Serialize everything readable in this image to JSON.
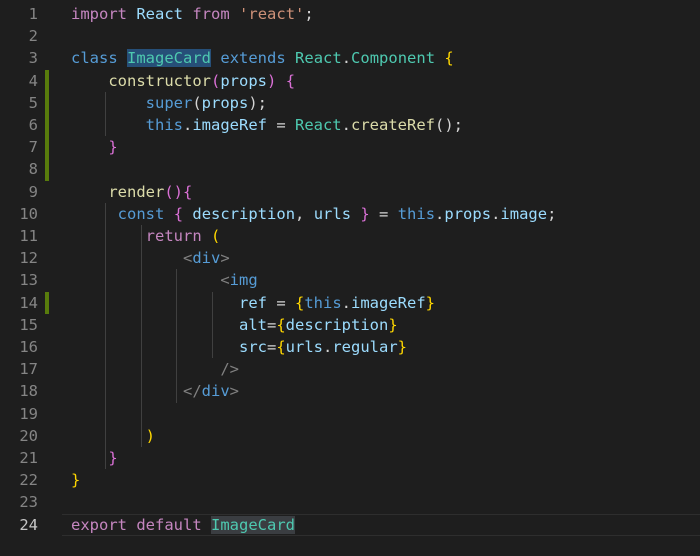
{
  "editor": {
    "active_line": "24",
    "lines": [
      {
        "n": "1",
        "tokens": [
          [
            "kw2",
            "import"
          ],
          [
            "plain",
            " "
          ],
          [
            "var",
            "React"
          ],
          [
            "plain",
            " "
          ],
          [
            "kw2",
            "from"
          ],
          [
            "plain",
            " "
          ],
          [
            "str",
            "'react'"
          ],
          [
            "plain",
            ";"
          ]
        ]
      },
      {
        "n": "2",
        "tokens": []
      },
      {
        "n": "3",
        "tokens": [
          [
            "kw",
            "class"
          ],
          [
            "plain",
            " "
          ],
          [
            "cls hl1",
            "ImageCard"
          ],
          [
            "plain",
            " "
          ],
          [
            "kw",
            "extends"
          ],
          [
            "plain",
            " "
          ],
          [
            "cls",
            "React"
          ],
          [
            "plain",
            "."
          ],
          [
            "cls",
            "Component"
          ],
          [
            "plain",
            " "
          ],
          [
            "brace",
            "{"
          ]
        ]
      },
      {
        "n": "4",
        "tokens": [
          [
            "plain",
            "    "
          ],
          [
            "fn",
            "constructor"
          ],
          [
            "paren",
            "("
          ],
          [
            "var",
            "props"
          ],
          [
            "paren",
            ")"
          ],
          [
            "plain",
            " "
          ],
          [
            "paren",
            "{"
          ]
        ]
      },
      {
        "n": "5",
        "tokens": [
          [
            "plain",
            "        "
          ],
          [
            "kw",
            "super"
          ],
          [
            "plain",
            "("
          ],
          [
            "var",
            "props"
          ],
          [
            "plain",
            ");"
          ]
        ]
      },
      {
        "n": "6",
        "tokens": [
          [
            "plain",
            "        "
          ],
          [
            "kw",
            "this"
          ],
          [
            "plain",
            "."
          ],
          [
            "var",
            "imageRef"
          ],
          [
            "plain",
            " = "
          ],
          [
            "cls",
            "React"
          ],
          [
            "plain",
            "."
          ],
          [
            "fn",
            "createRef"
          ],
          [
            "plain",
            "();"
          ]
        ]
      },
      {
        "n": "7",
        "tokens": [
          [
            "plain",
            "    "
          ],
          [
            "paren",
            "}"
          ]
        ]
      },
      {
        "n": "8",
        "tokens": []
      },
      {
        "n": "9",
        "tokens": [
          [
            "plain",
            "    "
          ],
          [
            "fn",
            "render"
          ],
          [
            "paren",
            "()"
          ],
          [
            "paren",
            "{"
          ]
        ]
      },
      {
        "n": "10",
        "tokens": [
          [
            "plain",
            "     "
          ],
          [
            "kw",
            "const"
          ],
          [
            "plain",
            " "
          ],
          [
            "paren",
            "{"
          ],
          [
            "plain",
            " "
          ],
          [
            "var",
            "description"
          ],
          [
            "plain",
            ", "
          ],
          [
            "var",
            "urls"
          ],
          [
            "plain",
            " "
          ],
          [
            "paren",
            "}"
          ],
          [
            "plain",
            " = "
          ],
          [
            "kw",
            "this"
          ],
          [
            "plain",
            "."
          ],
          [
            "var",
            "props"
          ],
          [
            "plain",
            "."
          ],
          [
            "var",
            "image"
          ],
          [
            "plain",
            ";"
          ]
        ]
      },
      {
        "n": "11",
        "tokens": [
          [
            "plain",
            "        "
          ],
          [
            "kw2",
            "return"
          ],
          [
            "plain",
            " "
          ],
          [
            "brace",
            "("
          ]
        ]
      },
      {
        "n": "12",
        "tokens": [
          [
            "plain",
            "            "
          ],
          [
            "tagbr",
            "<"
          ],
          [
            "tag",
            "div"
          ],
          [
            "tagbr",
            ">"
          ]
        ]
      },
      {
        "n": "13",
        "tokens": [
          [
            "plain",
            "                "
          ],
          [
            "tagbr",
            "<"
          ],
          [
            "tag",
            "img"
          ]
        ]
      },
      {
        "n": "14",
        "tokens": [
          [
            "plain",
            "                  "
          ],
          [
            "attr",
            "ref"
          ],
          [
            "plain",
            " = "
          ],
          [
            "brace",
            "{"
          ],
          [
            "kw",
            "this"
          ],
          [
            "plain",
            "."
          ],
          [
            "var",
            "imageRef"
          ],
          [
            "brace",
            "}"
          ]
        ]
      },
      {
        "n": "15",
        "tokens": [
          [
            "plain",
            "                  "
          ],
          [
            "attr",
            "alt"
          ],
          [
            "plain",
            "="
          ],
          [
            "brace",
            "{"
          ],
          [
            "var",
            "description"
          ],
          [
            "brace",
            "}"
          ]
        ]
      },
      {
        "n": "16",
        "tokens": [
          [
            "plain",
            "                  "
          ],
          [
            "attr",
            "src"
          ],
          [
            "plain",
            "="
          ],
          [
            "brace",
            "{"
          ],
          [
            "var",
            "urls"
          ],
          [
            "plain",
            "."
          ],
          [
            "var",
            "regular"
          ],
          [
            "brace",
            "}"
          ]
        ]
      },
      {
        "n": "17",
        "tokens": [
          [
            "plain",
            "                "
          ],
          [
            "tagbr",
            "/>"
          ]
        ]
      },
      {
        "n": "18",
        "tokens": [
          [
            "plain",
            "            "
          ],
          [
            "tagbr",
            "</"
          ],
          [
            "tag",
            "div"
          ],
          [
            "tagbr",
            ">"
          ]
        ]
      },
      {
        "n": "19",
        "tokens": []
      },
      {
        "n": "20",
        "tokens": [
          [
            "plain",
            "        "
          ],
          [
            "brace",
            ")"
          ]
        ]
      },
      {
        "n": "21",
        "tokens": [
          [
            "plain",
            "    "
          ],
          [
            "paren",
            "}"
          ]
        ]
      },
      {
        "n": "22",
        "tokens": [
          [
            "brace",
            "}"
          ]
        ]
      },
      {
        "n": "23",
        "tokens": []
      },
      {
        "n": "24",
        "tokens": [
          [
            "kw2",
            "export"
          ],
          [
            "plain",
            " "
          ],
          [
            "kw2",
            "default"
          ],
          [
            "plain",
            " "
          ],
          [
            "cls hl2",
            "ImageCard"
          ]
        ]
      }
    ],
    "modified_lines": [
      "4",
      "5",
      "6",
      "7",
      "8",
      "14"
    ]
  }
}
